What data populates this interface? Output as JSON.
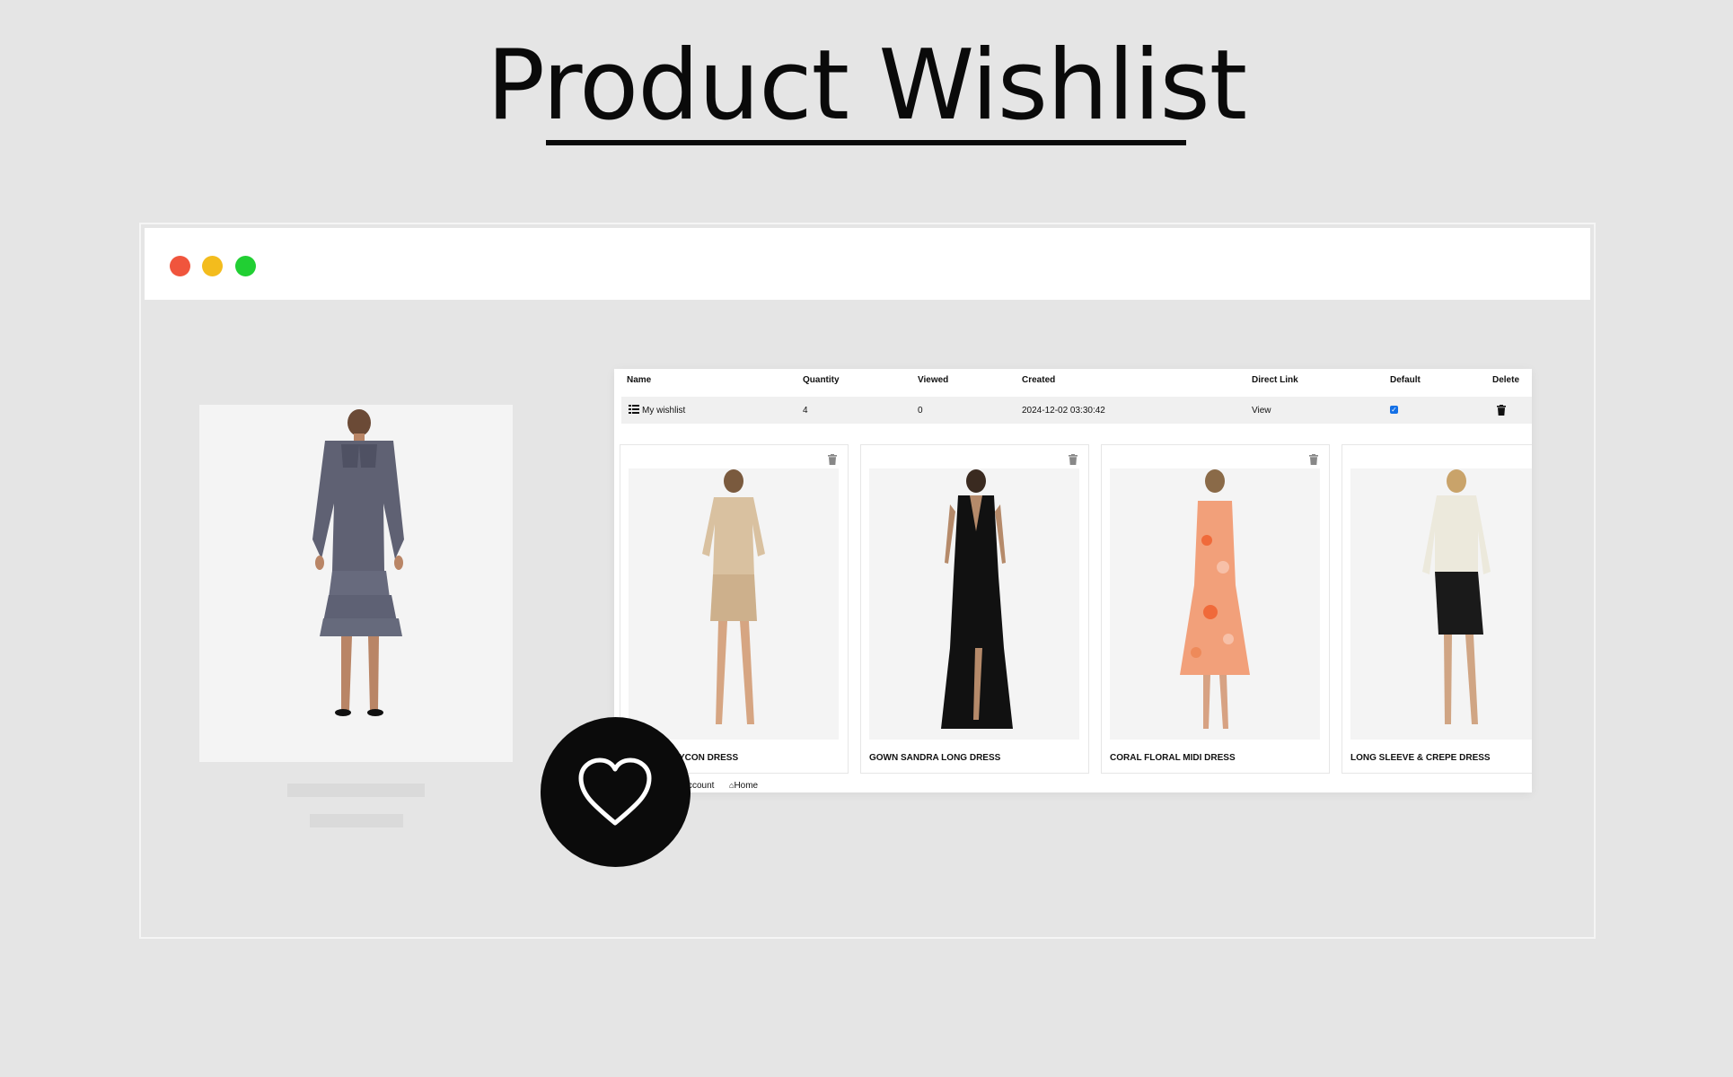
{
  "hero": {
    "title": "Product Wishlist"
  },
  "browser": {
    "window_controls": [
      "close",
      "minimize",
      "maximize"
    ]
  },
  "wishlist_table": {
    "headers": {
      "name": "Name",
      "quantity": "Quantity",
      "viewed": "Viewed",
      "created": "Created",
      "direct_link": "Direct Link",
      "default": "Default",
      "delete": "Delete"
    },
    "row": {
      "name": "My wishlist",
      "quantity": "4",
      "viewed": "0",
      "created": "2024-12-02 03:30:42",
      "direct_link": "View",
      "default_checked": true
    }
  },
  "items": [
    {
      "name": "BODYCON DRESS",
      "visible_name": "ODYCON DRESS",
      "dress_color": "#d9c1a0"
    },
    {
      "name": "GOWN SANDRA LONG DRESS",
      "dress_color": "#111111"
    },
    {
      "name": "CORAL FLORAL MIDI DRESS",
      "dress_color": "#f2a07a"
    },
    {
      "name": "LONG SLEEVE & CREPE DRESS",
      "dress_color": "#1a1a1a"
    }
  ],
  "footer": {
    "account_link": "ccount",
    "home_link": "Home"
  },
  "colors": {
    "accent_checkbox": "#1470e6",
    "badge": "#0b0b0b",
    "background": "#e5e5e5"
  }
}
